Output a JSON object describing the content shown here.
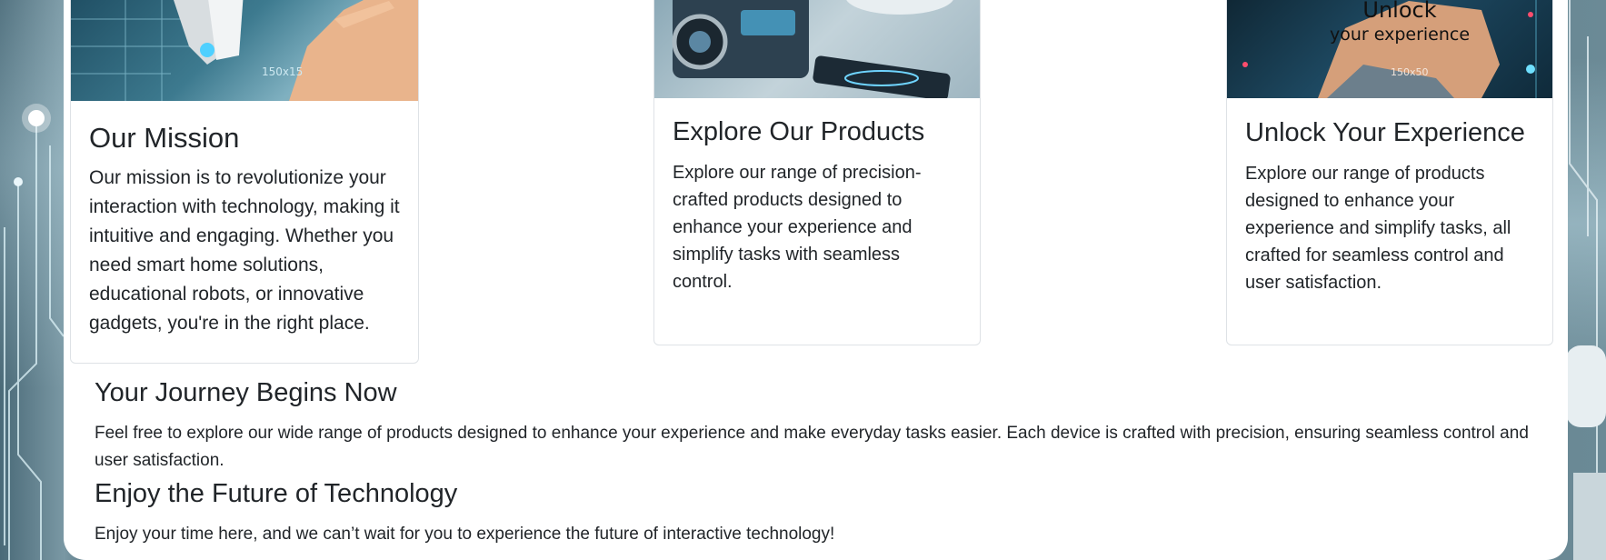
{
  "cards": [
    {
      "title": "Our Mission",
      "text": "Our mission is to revolutionize your interaction with technology, making it intuitive and engaging. Whether you need smart home solutions, educational robots, or innovative gadgets, you're in the right place.",
      "image_caption": "150x15"
    },
    {
      "title": "Explore Our Products",
      "text": "Explore our range of precision-crafted products designed to enhance your experience and simplify tasks with seamless control."
    },
    {
      "title": "Unlock Your Experience",
      "text": "Explore our range of products designed to enhance your experience and simplify tasks, all crafted for seamless control and user satisfaction.",
      "image_headline_1": "Unlock",
      "image_headline_2": "your experience",
      "image_caption": "150x50"
    }
  ],
  "sections": [
    {
      "title": "Your Journey Begins Now",
      "text": "Feel free to explore our wide range of products designed to enhance your experience and make everyday tasks easier. Each device is crafted with precision, ensuring seamless control and user satisfaction."
    },
    {
      "title": "Enjoy the Future of Technology",
      "text": "Enjoy your time here, and we can’t wait for you to experience the future of interactive technology!"
    }
  ],
  "colors": {
    "panel": "#ffffff",
    "border": "#dee2e6",
    "text": "#212529",
    "background": "#5d7a86"
  }
}
